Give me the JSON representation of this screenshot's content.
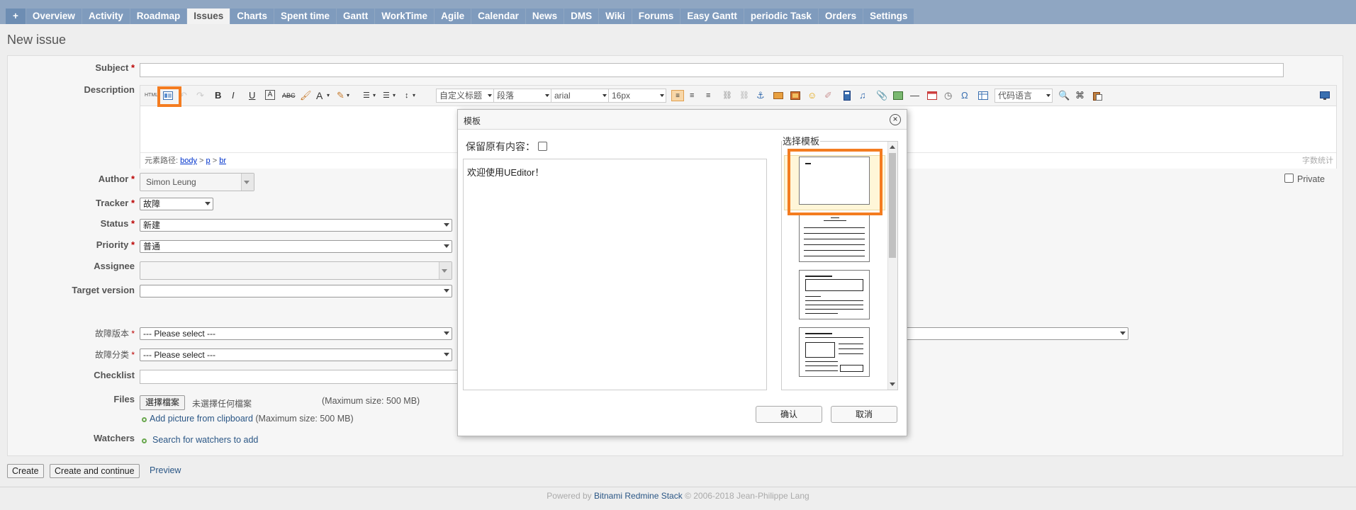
{
  "nav": {
    "plus_label": "+",
    "tabs": [
      "Overview",
      "Activity",
      "Roadmap",
      "Issues",
      "Charts",
      "Spent time",
      "Gantt",
      "WorkTime",
      "Agile",
      "Calendar",
      "News",
      "DMS",
      "Wiki",
      "Forums",
      "Easy Gantt",
      "periodic Task",
      "Orders",
      "Settings"
    ],
    "active_tab": "Issues"
  },
  "page": {
    "title": "New issue"
  },
  "form": {
    "subject_label": "Subject",
    "description_label": "Description",
    "required_mark": "*",
    "author_label": "Author",
    "author_value": "Simon Leung",
    "tracker_label": "Tracker",
    "tracker_value": "故障",
    "status_label": "Status",
    "status_value": "新建",
    "priority_label": "Priority",
    "priority_value": "普通",
    "assignee_label": "Assignee",
    "target_version_label": "Target version",
    "fault_version_label": "故障版本",
    "fault_version_value": "--- Please select ---",
    "fault_category_label": "故障分类",
    "fault_category_value": "--- Please select ---",
    "checklist_label": "Checklist",
    "files_label": "Files",
    "choose_file_button": "選擇檔案",
    "no_file_text": "未選擇任何檔案",
    "max_size_text": "(Maximum size: 500 MB)",
    "add_picture_link": "Add picture from clipboard",
    "add_picture_max": "(Maximum size: 500 MB)",
    "watchers_label": "Watchers",
    "search_watchers_link": "Search for watchers to add",
    "private_label": "Private"
  },
  "editor": {
    "html_label": "HTML",
    "bold": "B",
    "italic": "I",
    "underline": "U",
    "strike": "ABC",
    "fontcolor": "A",
    "heading_select": "自定义标题",
    "paragraph_select": "段落",
    "font_select": "arial",
    "size_select": "16px",
    "code_lang_select": "代码语言",
    "path_label": "元素路径:",
    "path_body": "body",
    "path_sep": ">",
    "path_p": "p",
    "path_br": "br",
    "wordcount_label": "字数统计"
  },
  "actions": {
    "create": "Create",
    "create_continue": "Create and continue",
    "preview": "Preview"
  },
  "footer": {
    "powered": "Powered by",
    "stack": "Bitnami Redmine Stack",
    "copyright": "© 2006-2018 Jean-Philippe Lang"
  },
  "modal": {
    "title": "模板",
    "close": "×",
    "keep_content_label": "保留原有内容：",
    "preview_text": "欢迎使用UEditor！",
    "choose_template_label": "选择模板",
    "ok_button": "确认",
    "cancel_button": "取消"
  },
  "colors": {
    "nav_bg": "#8fa6c2",
    "highlight": "#f47c20",
    "link": "#2a5685"
  }
}
